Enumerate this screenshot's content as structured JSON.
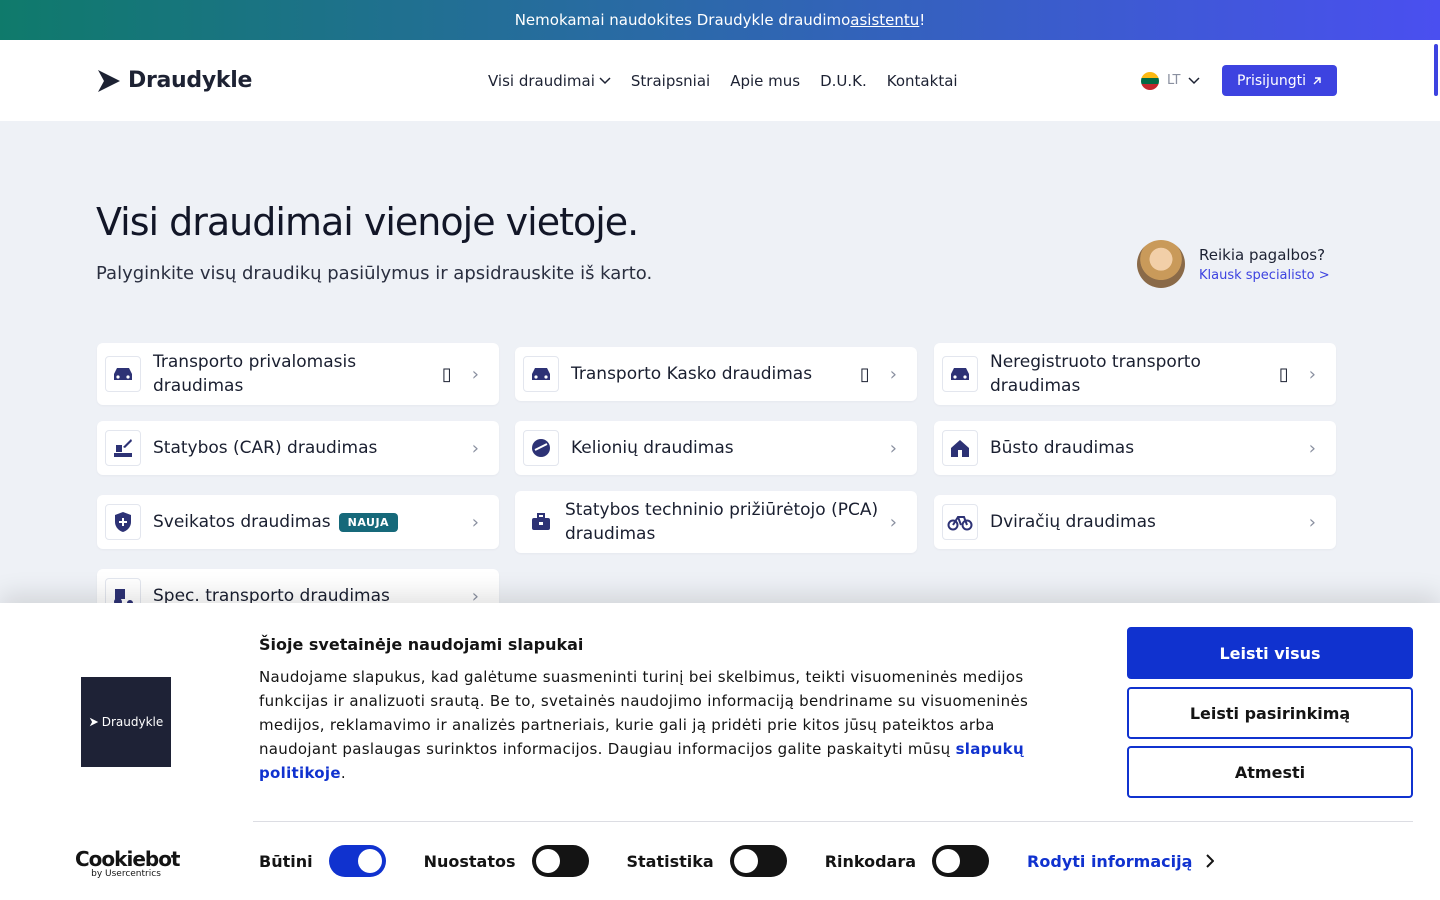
{
  "banner": {
    "text": "Nemokamai naudokites Draudykle draudimo ",
    "link": "asistentu",
    "end": "!"
  },
  "header": {
    "logo_text": "Draudykle",
    "nav": [
      "Visi draudimai",
      "Straipsniai",
      "Apie mus",
      "D.U.K.",
      "Kontaktai"
    ],
    "lang": "LT",
    "login_label": "Prisijungti"
  },
  "hero": {
    "title": "Visi draudimai vienoje vietoje.",
    "subtitle": "Palyginkite visų draudikų pasiūlymus ir apsidrauskite iš karto."
  },
  "help": {
    "title": "Reikia pagalbos?",
    "link": "Klausk specialisto >"
  },
  "cards": [
    {
      "label": "Transporto privalomasis draudimas",
      "icon": "car-icon"
    },
    {
      "label": "Transporto Kasko draudimas",
      "icon": "car-icon"
    },
    {
      "label": "Neregistruoto transporto draudimas",
      "icon": "car-icon"
    },
    {
      "label": "Statybos (CAR) draudimas",
      "icon": "construction-icon"
    },
    {
      "label": "Kelionių draudimas",
      "icon": "travel-icon"
    },
    {
      "label": "Būsto draudimas",
      "icon": "house-icon"
    },
    {
      "label": "Sveikatos draudimas",
      "icon": "health-shield-icon",
      "badge": "NAUJA"
    },
    {
      "label": "Statybos techninio prižiūrėtojo (PCA) draudimas",
      "icon": "briefcase-icon"
    },
    {
      "label": "Dviračių draudimas",
      "icon": "bicycle-icon"
    },
    {
      "label": "Spec. transporto draudimas",
      "icon": "tractor-icon"
    }
  ],
  "cookie": {
    "logo_text": "Draudykle",
    "title": "Šioje svetainėje naudojami slapukai",
    "text": "Naudojame slapukus, kad galėtume suasmeninti turinį bei skelbimus, teikti visuomeninės medijos funkcijas ir analizuoti srautą. Be to, svetainės naudojimo informaciją bendriname su visuomeninės medijos, reklamavimo ir analizės partneriais, kurie gali ją pridėti prie kitos jūsų pateiktos arba naudojant paslaugas surinktos informacijos. Daugiau informacijos galite paskaityti mūsų ",
    "policy_link": "slapukų politikoje",
    "text_end": ".",
    "buttons": {
      "allow_all": "Leisti visus",
      "allow_selection": "Leisti pasirinkimą",
      "deny": "Atmesti"
    },
    "toggles": [
      {
        "label": "Būtini",
        "on": true
      },
      {
        "label": "Nuostatos",
        "on": false
      },
      {
        "label": "Statistika",
        "on": false
      },
      {
        "label": "Rinkodara",
        "on": false
      }
    ],
    "show_details": "Rodyti informaciją",
    "brand": "Cookiebot",
    "brand_sub": "by Usercentrics"
  },
  "colors": {
    "accent": "#3d43e0",
    "cookie_blue": "#1032cf",
    "badge": "#16697a"
  }
}
